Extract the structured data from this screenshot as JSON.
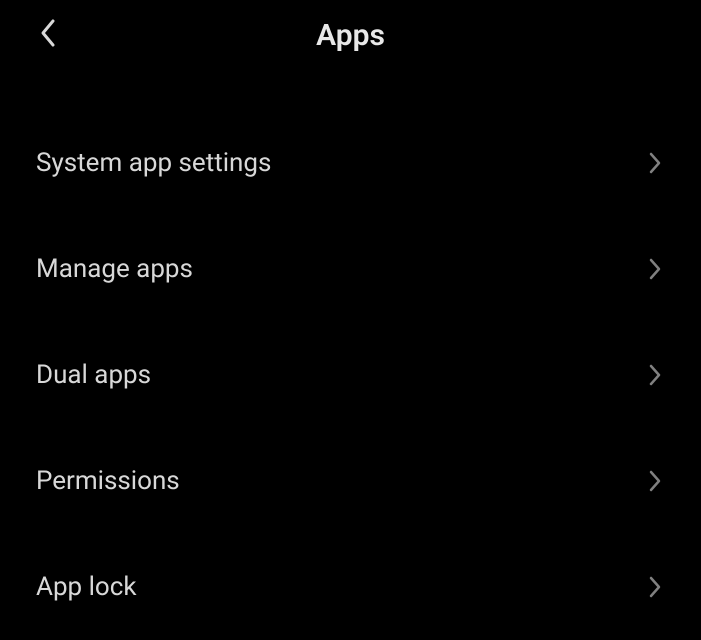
{
  "header": {
    "title": "Apps"
  },
  "items": [
    {
      "label": "System app settings"
    },
    {
      "label": "Manage apps"
    },
    {
      "label": "Dual apps"
    },
    {
      "label": "Permissions"
    },
    {
      "label": "App lock"
    }
  ]
}
